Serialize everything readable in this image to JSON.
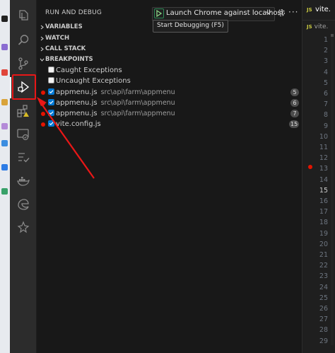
{
  "colors": {
    "accent_blue": "#0078d4",
    "breakpoint_red": "#e51400",
    "annotation_red": "#e81717",
    "start_green": "#89d185"
  },
  "activity_bar": {
    "icons": [
      "files-icon",
      "search-icon",
      "source-control-icon",
      "run-debug-icon",
      "extensions-icon",
      "remote-explorer-icon",
      "testing-icon",
      "docker-icon",
      "edge-icon",
      "ai-icon"
    ]
  },
  "sidebar": {
    "title": "RUN AND DEBUG",
    "launch_config": "Launch Chrome against localhost",
    "start_tooltip": "Start Debugging (F5)",
    "sections": {
      "variables": "VARIABLES",
      "watch": "WATCH",
      "call_stack": "CALL STACK",
      "breakpoints": "BREAKPOINTS"
    },
    "exceptions": [
      {
        "label": "Caught Exceptions",
        "checked": false
      },
      {
        "label": "Uncaught Exceptions",
        "checked": false
      }
    ],
    "breakpoints": [
      {
        "file": "appmenu.js",
        "path": "src\\api\\farm\\appmenu",
        "line": "5"
      },
      {
        "file": "appmenu.js",
        "path": "src\\api\\farm\\appmenu",
        "line": "6"
      },
      {
        "file": "appmenu.js",
        "path": "src\\api\\farm\\appmenu",
        "line": "7"
      },
      {
        "file": "vite.config.js",
        "path": "",
        "line": "15"
      }
    ]
  },
  "editor": {
    "tab_label": "vite.",
    "breadcrumb": "vite.",
    "lines": [
      "1",
      "2",
      "3",
      "4",
      "5",
      "6",
      "7",
      "8",
      "9",
      "10",
      "11",
      "12",
      "13",
      "14",
      "15",
      "16",
      "17",
      "18",
      "19",
      "20",
      "21",
      "22",
      "23",
      "24",
      "25",
      "26",
      "27",
      "28",
      "29"
    ],
    "current_line": "15"
  }
}
